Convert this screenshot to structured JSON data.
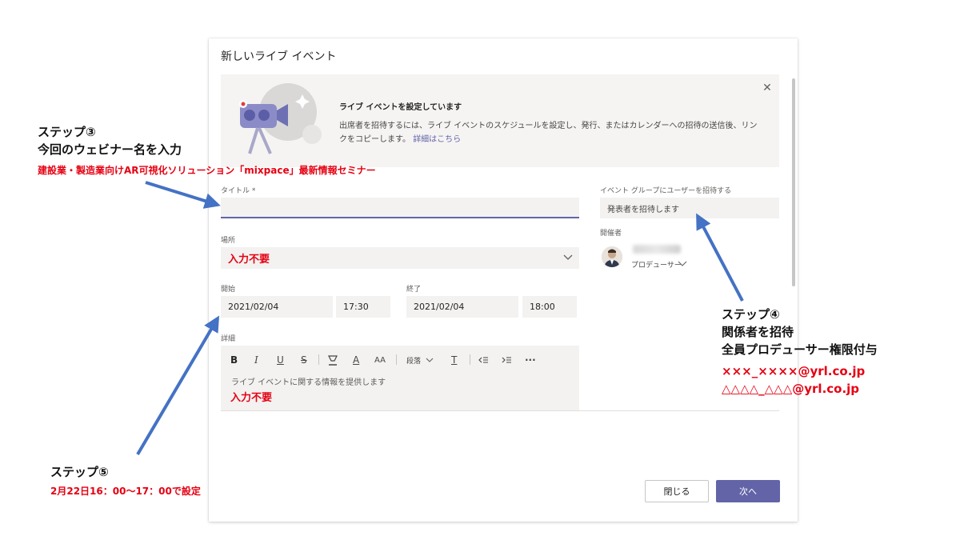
{
  "dialog": {
    "title": "新しいライブ イベント",
    "banner": {
      "title": "ライブ イベントを設定しています",
      "body": "出席者を招待するには、ライブ イベントのスケジュールを設定し、発行、またはカレンダーへの招待の送信後、リンクをコピーします。",
      "link": "詳細はこちら",
      "close_icon": "close-icon"
    },
    "title_label": "タイトル *",
    "title_value": "",
    "location_label": "場所",
    "location_value": "入力不要",
    "start_label": "開始",
    "start_date": "2021/02/04",
    "start_time": "17:30",
    "end_label": "終了",
    "end_date": "2021/02/04",
    "end_time": "18:00",
    "details_label": "詳細",
    "toolbar": {
      "bold": "B",
      "italic": "I",
      "underline": "U",
      "strike": "S",
      "highlight": "highlight-icon",
      "font_color": "A",
      "font_size": "AA",
      "paragraph": "段落",
      "clear_format": "T",
      "more": "···"
    },
    "details_placeholder": "ライブ イベントに関する情報を提供します",
    "details_value": "入力不要",
    "invite_label": "イベント グループにユーザーを招待する",
    "invite_placeholder": "発表者を招待します",
    "organizer_label": "開催者",
    "organizer_role": "プロデューサー",
    "close_button": "閉じる",
    "next_button": "次へ"
  },
  "annotations": {
    "step3_title": "ステップ③",
    "step3_desc": "今回のウェビナー名を入力",
    "step3_red": "建設業・製造業向けAR可視化ソリューション「mixpace」最新情報セミナー",
    "step4_title": "ステップ④",
    "step4_desc1": "関係者を招待",
    "step4_desc2": "全員プロデューサー権限付与",
    "step4_red1": "×××_××××@yrl.co.jp",
    "step4_red2": "△△△△_△△△@yrl.co.jp",
    "step5_title": "ステップ⑤",
    "step5_red": "2月22日16：00～17：00で設定"
  },
  "colors": {
    "accent": "#6264a7",
    "arrow": "#4472c4",
    "annotation_red": "#e60012"
  }
}
